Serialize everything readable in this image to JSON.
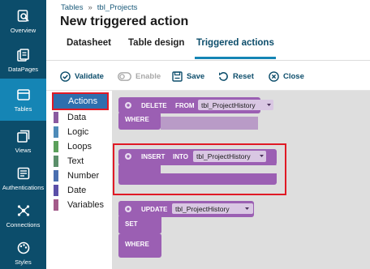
{
  "nav": {
    "items": [
      {
        "label": "Overview",
        "icon": "search-doc-icon"
      },
      {
        "label": "DataPages",
        "icon": "pages-icon"
      },
      {
        "label": "Tables",
        "icon": "table-icon",
        "active": true
      },
      {
        "label": "Views",
        "icon": "views-icon"
      },
      {
        "label": "Authentications",
        "icon": "auth-icon"
      },
      {
        "label": "Connections",
        "icon": "connections-icon"
      },
      {
        "label": "Styles",
        "icon": "styles-icon"
      }
    ]
  },
  "breadcrumb": {
    "root": "Tables",
    "separator": "»",
    "current": "tbl_Projects"
  },
  "page": {
    "title": "New triggered action"
  },
  "tabs": [
    "Datasheet",
    "Table design",
    "Triggered actions"
  ],
  "toolbar": {
    "validate": "Validate",
    "enable": "Enable",
    "save": "Save",
    "reset": "Reset",
    "close": "Close"
  },
  "toolbox": {
    "categories": [
      {
        "name": "Actions",
        "color": "#2e6fae"
      },
      {
        "name": "Data",
        "color": "#8a5aa0"
      },
      {
        "name": "Logic",
        "color": "#4e8bb8"
      },
      {
        "name": "Loops",
        "color": "#5ba05b"
      },
      {
        "name": "Text",
        "color": "#5b8f6a"
      },
      {
        "name": "Number",
        "color": "#4a6fb0"
      },
      {
        "name": "Date",
        "color": "#5b4fa8"
      },
      {
        "name": "Variables",
        "color": "#a35b8a"
      }
    ]
  },
  "blocks": {
    "delete": {
      "kw1": "DELETE",
      "kw2": "FROM",
      "table": "tbl_ProjectHistory",
      "where": "WHERE"
    },
    "insert": {
      "kw1": "INSERT",
      "kw2": "INTO",
      "table": "tbl_ProjectHistory"
    },
    "update": {
      "kw1": "UPDATE",
      "table": "tbl_ProjectHistory",
      "set": "SET",
      "where": "WHERE"
    }
  },
  "colors": {
    "sidebar": "#0c4d6b",
    "active_nav": "#1585b5",
    "block": "#9b5fb3",
    "highlight": "#e01a25"
  }
}
